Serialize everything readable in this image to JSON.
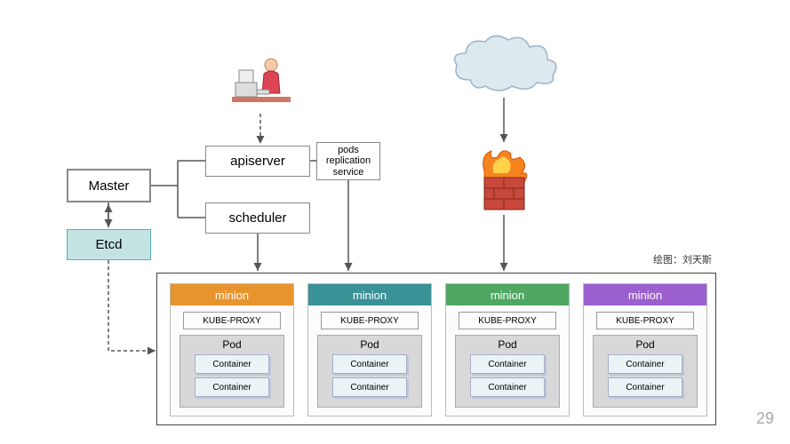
{
  "master": {
    "label": "Master"
  },
  "etcd": {
    "label": "Etcd"
  },
  "apiserver": {
    "label": "apiserver"
  },
  "scheduler": {
    "label": "scheduler"
  },
  "pods_box": {
    "line1": "pods",
    "line2": "replication",
    "line3": "service"
  },
  "minions": [
    {
      "label": "minion",
      "color": "#e8942e",
      "kube_proxy": "KUBE-PROXY",
      "pod_label": "Pod",
      "containers": [
        "Container",
        "Container"
      ]
    },
    {
      "label": "minion",
      "color": "#3a9297",
      "kube_proxy": "KUBE-PROXY",
      "pod_label": "Pod",
      "containers": [
        "Container",
        "Container"
      ]
    },
    {
      "label": "minion",
      "color": "#4ea861",
      "kube_proxy": "KUBE-PROXY",
      "pod_label": "Pod",
      "containers": [
        "Container",
        "Container"
      ]
    },
    {
      "label": "minion",
      "color": "#9b5fcf",
      "kube_proxy": "KUBE-PROXY",
      "pod_label": "Pod",
      "containers": [
        "Container",
        "Container"
      ]
    }
  ],
  "minion_positions": [
    191,
    346,
    501,
    656
  ],
  "credit": "绘图：刘天斯",
  "page_number": "29",
  "icons": {
    "user": "User at computer",
    "cloud": "Cloud (internet)",
    "firewall": "Firewall"
  }
}
